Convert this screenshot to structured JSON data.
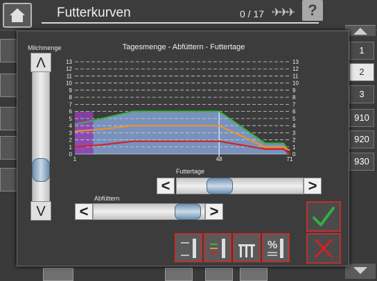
{
  "header": {
    "title": "Futterkurven",
    "counter": "0 / 17",
    "help_label": "?"
  },
  "side_numbers": [
    "1",
    "2",
    "3",
    "910",
    "920",
    "930"
  ],
  "side_selected": "2",
  "dialog": {
    "milch_label": "Milchmenge",
    "up_label": "Λ",
    "down_label": "V",
    "futtertage_label": "Futtertage",
    "abfuettern_label": "Abfüttern",
    "left_arrow": "<",
    "right_arrow": ">"
  },
  "chart_data": {
    "type": "area",
    "title": "Tagesmenge - Abfüttern - Futtertage",
    "y_ticks": [
      0,
      1,
      2,
      3,
      4,
      5,
      6,
      7,
      8,
      9,
      10,
      11,
      12,
      13
    ],
    "ylim": [
      0,
      13
    ],
    "x_ticks": [
      "1",
      "48",
      "71"
    ],
    "x_range": [
      1,
      71
    ],
    "grid": true,
    "marker_x": 48,
    "highlight_x": [
      1,
      7
    ],
    "series": [
      {
        "color": "#3cb04a",
        "points": [
          [
            1,
            4.2
          ],
          [
            10,
            5
          ],
          [
            20,
            6
          ],
          [
            48,
            6
          ],
          [
            63,
            1.5
          ],
          [
            69,
            1.5
          ],
          [
            70,
            0.9
          ]
        ]
      },
      {
        "color": "#f09030",
        "points": [
          [
            1,
            3.2
          ],
          [
            10,
            3.5
          ],
          [
            20,
            4
          ],
          [
            48,
            4
          ],
          [
            63,
            1
          ],
          [
            69,
            1
          ],
          [
            71,
            0.5
          ]
        ]
      },
      {
        "color": "#d52020",
        "points": [
          [
            1,
            1
          ],
          [
            10,
            1.3
          ],
          [
            20,
            1.8
          ],
          [
            48,
            1.8
          ],
          [
            63,
            0.7
          ],
          [
            69,
            0.7
          ],
          [
            71,
            0
          ]
        ]
      }
    ],
    "colors": {
      "plot_bg": "#808080",
      "area": "#7b97c4",
      "highlight": "#8e40b0",
      "grid": "#d0d0d0"
    }
  }
}
